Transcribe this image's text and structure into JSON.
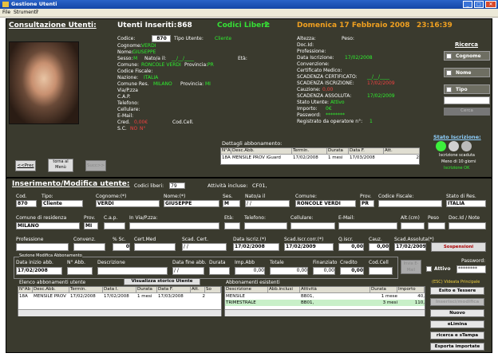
{
  "window": {
    "title": "Gestione Utenti",
    "menu": [
      "File",
      "Strumenti",
      "?"
    ]
  },
  "header": {
    "section_title": "Consultazione Utenti:",
    "users_label": "Utenti Inseriti:",
    "users_count": "868",
    "free_label": "Codici Liberi:",
    "free_count": "2",
    "date": "Domenica 17 Febbraio 2008",
    "time": "23:16:39"
  },
  "consult": {
    "codice_label": "Codice:",
    "codice": "870",
    "tipo_label": "Tipo Utente:",
    "tipo": "Cliente",
    "cognome_label": "Cognome:",
    "cognome": "VERDI",
    "nome_label": "Nome:",
    "nome": "GIUSEPPE",
    "sesso_label": "Sesso:",
    "sesso": "M",
    "nato_label": "Nato/a il:",
    "nato": "__/__/____",
    "eta_label": "Età:",
    "comune_label": "Comune:",
    "comune": "RONCOLE VERDI",
    "provincia_label": "Provincia:",
    "provincia": "PR",
    "cf_label": "Codice Fiscale:",
    "nazione_label": "Nazione:",
    "nazione": "ITALIA",
    "comres_label": "Comune Res.",
    "comres": "MILANO",
    "provres_label": "Provincia:",
    "provres": "MI",
    "via_label": "Via/P.zza",
    "cap_label": "C.A.P.",
    "tel_label": "Telefono:",
    "cell_label": "Cellulare:",
    "email_label": "E-Mail:",
    "cred_label": "Cred.",
    "cred": "0,00€",
    "codcell_label": "Cod.Cell.",
    "sc_label": "S.C.",
    "sc": "NO",
    "sc2": "N°"
  },
  "right_info": {
    "altezza": "Altezza:",
    "peso": "Peso:",
    "docid": "Doc.Id:",
    "professione": "Professione:",
    "data_iscr_label": "Data Iscrizione:",
    "data_iscr": "17/02/2008",
    "convenzione": "Convenzione:",
    "certificato": "Certificato Medico:",
    "scad_cert_label": "SCADENZA CERTIFICATO:",
    "scad_cert": "__/__/____",
    "scad_iscr_label": "SCADENZA ISCRIZIONE:",
    "scad_iscr": "17/02/2009",
    "cauzione_label": "Cauzione:",
    "cauzione": "0,00",
    "scad_ass_label": "SCADENZA ASSOLUTA:",
    "scad_ass": "17/02/2009",
    "stato_label": "Stato Utente:",
    "stato": "Attivo",
    "importo_label": "Importo:",
    "importo": "0€",
    "password_label": "Password:",
    "password": "********",
    "registrato_label": "Registrato da operatore n°:",
    "registrato": "1"
  },
  "ricerca": {
    "title": "Ricerca",
    "opts": [
      "Cognome",
      "Nome",
      "Tipo"
    ],
    "cerca": "Cerca"
  },
  "stato_iscr": {
    "title": "Stato Iscrizione:",
    "l1": "Iscrizione scaduta",
    "l2": "Meno di 10 giorni",
    "l3": "Iscrizione OK"
  },
  "nav": {
    "prec": "<<Prec",
    "menu": "torna al Menù",
    "succ": "Succ>>"
  },
  "abbon": {
    "title": "Dettagli abbonamento:",
    "cols": [
      "N°Ab",
      "Desc.Abb.",
      "Termin.",
      "Durata",
      "Data F.",
      "Att."
    ],
    "row": [
      "18A",
      "MENSILE PROV iGuard",
      "17/02/2008",
      "1 mesi",
      "17/03/2008",
      "2"
    ]
  },
  "ins": {
    "title": "Inserimento/Modifica utente:",
    "codici_liberi_label": "Codici liberi:",
    "codici_liberi": "79",
    "attivita_label": "Attività incluse:",
    "attivita": "CF01,",
    "cod_label": "Cod.",
    "cod": "870",
    "tipo_label": "Tipo:",
    "tipo": "Cliente",
    "cognome_label": "Cognome:(*)",
    "cognome": "VERDI",
    "nome_label": "Nome:(*)",
    "nome": "GIUSEPPE",
    "ses_label": "Ses.",
    "ses": "M",
    "nato_label": "Nato/a il",
    "nato": "/ /",
    "comune_label": "Comune:",
    "comune": "RONCOLE VERDI",
    "prov_label": "Prov.",
    "prov": "PR",
    "cf_label": "Codice Fiscale:",
    "stato_res_label": "Stato di Res.",
    "stato_res": "ITALIA",
    "comres_label": "Comune di residenza",
    "comres": "MILANO",
    "prov2_label": "Prov.",
    "prov2": "MI",
    "cap_label": "C.a.p.",
    "via_label": "In Via/P.zza:",
    "eta_label": "Età:",
    "tel_label": "Telefono:",
    "cell_label": "Cellulare:",
    "email_label": "E-Mail:",
    "alt_label": "Alt.(cm)",
    "peso_label": "Peso",
    "docid_label": "Doc.Id / Note",
    "prof_label": "Professione",
    "conv_label": "Convenz.",
    "sc_label": "% Sc.",
    "sc_val": "0",
    "cert_label": "Cert.Med",
    "scad_cert_label": "Scad. Cert.",
    "scad_cert": "/ /",
    "data_iscr_label": "Data Iscriz.(*)",
    "data_iscr": "17/02/2008",
    "scad_corr_label": "Scad.Iscr.corr.(*)",
    "scad_corr": "17/02/2009",
    "qiscr_label": "Q.iscr.",
    "qiscr": "0,00",
    "cauz_label": "Cauz.",
    "cauz": "0,00",
    "scad_ass_label": "Scad.Assoluta(*)",
    "scad_ass": "17/02/2009",
    "sospensioni": "Sospensioni",
    "sez_mod_label": "Sezione Modifica Abbonamento",
    "data_inizio_label": "Data inizio abb.",
    "data_inizio": "17/02/2008",
    "nabb_label": "N° Abb.",
    "desc_label": "Descrizione",
    "data_fine_label": "Data fine abb.",
    "data_fine": "/ /",
    "durata_label": "Durata",
    "impabb_label": "Imp.Abb",
    "impabb": "0,00",
    "totale_label": "Totale",
    "totale": "0,00",
    "finanz_label": "Finanziato",
    "finanz": "0,00",
    "credito_label": "Credito",
    "credito": "0,00",
    "codcell_label": "Cod.Cell",
    "invia_sms": "Invia E-Mail",
    "attivo_label": "Attivo",
    "password_label": "Password:",
    "password": "********"
  },
  "elenco": {
    "title": "Elenco abbonamenti utente",
    "storico_btn": "Visualizza storico Utente",
    "cols": [
      "N°Ab",
      "Desc.Abb.",
      "Termin.",
      "Data I.",
      "Durata",
      "Data F.",
      "Att.",
      "So"
    ],
    "row": [
      "18A",
      "MENSILE PROV",
      "17/02/2008",
      "17/02/2008",
      "1 mesi",
      "17/03/2008",
      "2",
      ""
    ]
  },
  "esistenti": {
    "title": "Abbonamenti esistenti",
    "cols": [
      "Descrizione",
      "Abb.inclusi",
      "Attività",
      "Durata",
      "Importo"
    ],
    "rows": [
      [
        "MENSILE",
        "",
        "BB01,",
        "1 mese",
        "40,"
      ],
      [
        "TRIMESTRALE",
        "",
        "BB01,",
        "3 mesi",
        "110,"
      ]
    ]
  },
  "right_buttons": {
    "hint": "(ESC) Videata Principale",
    "btns": [
      "Esito e Tessere",
      "Inserisci/modifica",
      "Nuovo",
      "eLimina",
      "ricerca e sTampa",
      "Esporta importate"
    ]
  }
}
